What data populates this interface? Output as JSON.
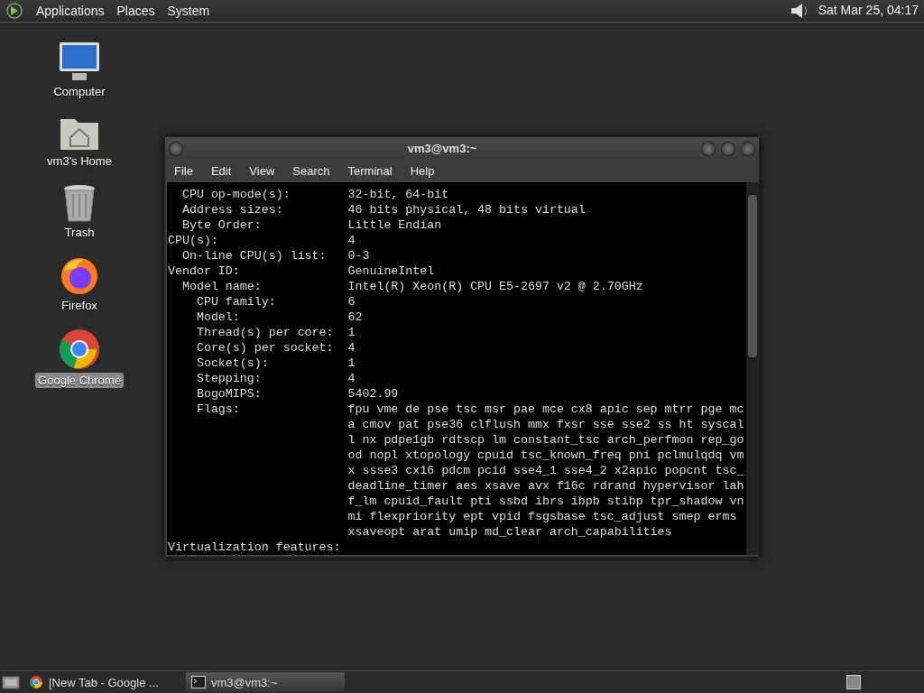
{
  "top_panel": {
    "menus": [
      "Applications",
      "Places",
      "System"
    ],
    "clock": "Sat Mar 25, 04:17"
  },
  "desktop_icons": [
    {
      "label": "Computer",
      "kind": "computer",
      "selected": false
    },
    {
      "label": "vm3's Home",
      "kind": "home",
      "selected": false
    },
    {
      "label": "Trash",
      "kind": "trash",
      "selected": false
    },
    {
      "label": "Firefox",
      "kind": "firefox",
      "selected": false
    },
    {
      "label": "Google Chrome",
      "kind": "chrome",
      "selected": true
    }
  ],
  "window": {
    "title": "vm3@vm3:~",
    "menu": [
      "File",
      "Edit",
      "View",
      "Search",
      "Terminal",
      "Help"
    ],
    "lines": [
      "  CPU op-mode(s):        32-bit, 64-bit",
      "  Address sizes:         46 bits physical, 48 bits virtual",
      "  Byte Order:            Little Endian",
      "CPU(s):                  4",
      "  On-line CPU(s) list:   0-3",
      "Vendor ID:               GenuineIntel",
      "  Model name:            Intel(R) Xeon(R) CPU E5-2697 v2 @ 2.70GHz",
      "    CPU family:          6",
      "    Model:               62",
      "    Thread(s) per core:  1",
      "    Core(s) per socket:  4",
      "    Socket(s):           1",
      "    Stepping:            4",
      "    BogoMIPS:            5402.99",
      "    Flags:               fpu vme de pse tsc msr pae mce cx8 apic sep mtrr pge mc",
      "                         a cmov pat pse36 clflush mmx fxsr sse sse2 ss ht syscal",
      "                         l nx pdpe1gb rdtscp lm constant_tsc arch_perfmon rep_go",
      "                         od nopl xtopology cpuid tsc_known_freq pni pclmulqdq vm",
      "                         x ssse3 cx16 pdcm pcid sse4_1 sse4_2 x2apic popcnt tsc_",
      "                         deadline_timer aes xsave avx f16c rdrand hypervisor lah",
      "                         f_lm cpuid_fault pti ssbd ibrs ibpb stibp tpr_shadow vn",
      "                         mi flexpriority ept vpid fsgsbase tsc_adjust smep erms",
      "                         xsaveopt arat umip md_clear arch_capabilities",
      "Virtualization features:"
    ]
  },
  "taskbar": {
    "tasks": [
      {
        "label": "[New Tab - Google ...",
        "kind": "chrome",
        "selected": false
      },
      {
        "label": "vm3@vm3:~",
        "kind": "terminal",
        "selected": true
      }
    ]
  }
}
